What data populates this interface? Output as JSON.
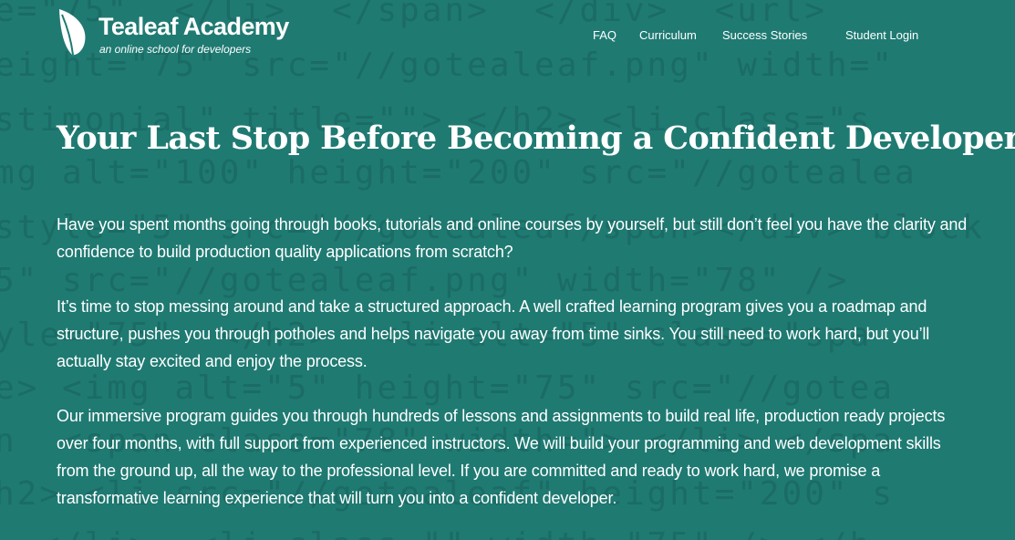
{
  "background_code_lines": [
    "e=\"75\"  </li>  </span>  </div>  <url>",
    "eight=\"75\" src=\"//gotealeaf.png\" width=\"",
    "stimonial\" title=\"\"> </h2> <li class=\"s",
    "mg alt=\"100\" height=\"200\" src=\"//gotealea",
    "style=\"5\" src=\"//gotealeaf/span></div> block",
    "5\" src=\"//gotealeaf.png\" width=\"78\" />",
    "yle=\"75\"  </h2>  <li alt=\"5\" class=\"spa",
    "e> <img alt=\"5\" height=\"75\" src=\"//gotea",
    "n  <span class=\"78\" width=\"> </li> </spa",
    "h2> <li src=\"//gotealeaf\" height=\"200\" s",
    "  </li>  <li class=\"\" width=\"75\" /> </h"
  ],
  "colors": {
    "background": "#1f7a72",
    "text": "#ffffff"
  },
  "logo": {
    "icon": "leaf-icon",
    "name": "Tealeaf Academy",
    "tagline": "an online school for developers"
  },
  "nav": {
    "faq": "FAQ",
    "curriculum": "Curriculum",
    "success_stories": "Success Stories",
    "student_login": "Student Login"
  },
  "hero": {
    "headline": "Your Last Stop Before Becoming a Confident Developer",
    "paragraphs": [
      "Have you spent months going through books, tutorials and online courses by yourself, but still don’t feel you have the clarity and confidence to build production quality applications from scratch?",
      "It’s time to stop messing around and take a structured approach. A well crafted learning program gives you a roadmap and structure, pushes you through potholes and helps navigate you away from time sinks. You still need to work hard, but you’ll actually stay excited and enjoy the process.",
      "Our immersive program guides you through hundreds of lessons and assignments to build real life, production ready projects over four months, with full support from experienced instructors. We will build your programming and web development skills from the ground up, all the way to the professional level. If you are committed and ready to work hard, we promise a transformative learning experience that will turn you into a confident developer."
    ]
  }
}
